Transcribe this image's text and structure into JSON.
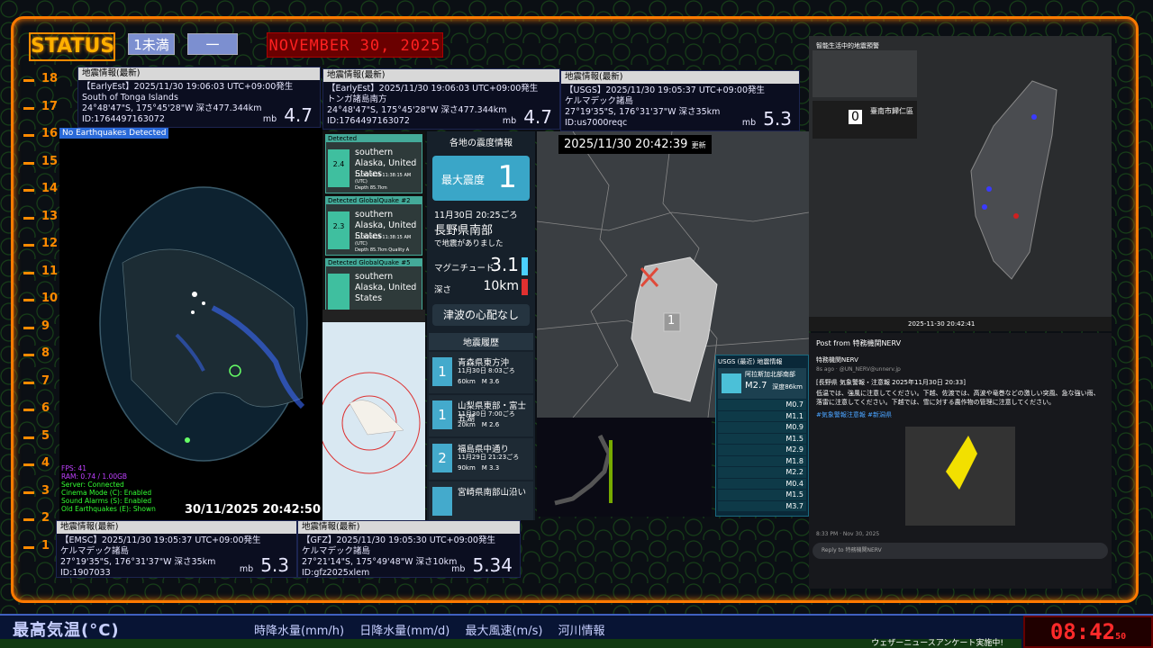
{
  "header": {
    "status": "STATUS",
    "pill1": "1未満",
    "pill2": "一",
    "date": "NOVEMBER 30, 2025"
  },
  "scale": [
    "18",
    "17",
    "16",
    "15",
    "14",
    "13",
    "12",
    "11",
    "10",
    "9",
    "8",
    "7",
    "6",
    "5",
    "4",
    "3",
    "2",
    "1"
  ],
  "cards": [
    {
      "hd": "地震情報(最新)",
      "l1": "【EarlyEst】2025/11/30 19:06:03 UTC+09:00発生",
      "l2": "South of Tonga Islands",
      "l3": "24°48'47\"S, 175°45'28\"W 深さ477.344km",
      "l4": "ID:1764497163072",
      "mb": "mb",
      "val": "4.7"
    },
    {
      "hd": "地震情報(最新)",
      "l1": "【EarlyEst】2025/11/30 19:06:03 UTC+09:00発生",
      "l2": "トンガ諸島南方",
      "l3": "24°48'47\"S, 175°45'28\"W 深さ477.344km",
      "l4": "ID:1764497163072",
      "mb": "mb",
      "val": "4.7"
    },
    {
      "hd": "地震情報(最新)",
      "l1": "【USGS】2025/11/30 19:05:37 UTC+09:00発生",
      "l2": "ケルマデック諸島",
      "l3": "27°19'35\"S, 176°31'37\"W 深さ35km",
      "l4": "ID:us7000reqc",
      "mb": "mb",
      "val": "5.3"
    },
    {
      "hd": "地震情報(最新)",
      "l1": "【EMSC】2025/11/30 19:05:37 UTC+09:00発生",
      "l2": "ケルマデック諸島",
      "l3": "27°19'35\"S, 176°31'37\"W 深さ35km",
      "l4": "ID:1907033",
      "mb": "mb",
      "val": "5.3"
    },
    {
      "hd": "地震情報(最新)",
      "l1": "【GFZ】2025/11/30 19:05:30 UTC+09:00発生",
      "l2": "ケルマデック諸島",
      "l3": "27°21'14\"S, 175°49'48\"W 深さ10km",
      "l4": "ID:gfz2025xlem",
      "mb": "mb",
      "val": "5.34"
    }
  ],
  "globe": {
    "tag": "No Earthquakes Detected",
    "stats": [
      "FPS: 41",
      "RAM: 0.74 / 1.00GB",
      "Server: Connected",
      "Cinema Mode (C): Enabled",
      "Sound Alarms (S): Enabled",
      "Old Earthquakes (E): Shown"
    ],
    "timestamp": "30/11/2025 20:42:50"
  },
  "gq": {
    "items": [
      {
        "tag": "Detected",
        "src": "",
        "num": "",
        "place": "southern Alaska, United States",
        "mag": "2.4",
        "meta1": "11/30/2025 11:38:15 AM (UTC)",
        "meta2": "Depth 85.7km"
      },
      {
        "tag": "Detected",
        "src": "GlobalQuake",
        "num": "#2",
        "place": "southern Alaska, United States",
        "mag": "2.3",
        "meta1": "11/30/2025 11:38:15 AM (UTC)",
        "meta2": "Depth 85.7km  Quality A"
      },
      {
        "tag": "Detected",
        "src": "GlobalQuake",
        "num": "#5",
        "place": "southern Alaska, United States",
        "mag": "",
        "meta1": "",
        "meta2": ""
      }
    ]
  },
  "shindo": {
    "header": "各地の震度情報",
    "max_label": "最大震度",
    "max_val": "1",
    "datetime": "11月30日 20:25ごろ",
    "place": "長野県南部",
    "msg": "で地震がありました",
    "mag_label": "マグニチュード",
    "mag_val": "3.1",
    "depth_label": "深さ",
    "depth_val": "10km",
    "tsunami": "津波の心配なし",
    "history_label": "地震履歴",
    "history": [
      {
        "lvl": "1",
        "place": "青森県東方沖",
        "time": "11月30日 8:03ごろ",
        "depth": "60km",
        "mag": "M 3.6"
      },
      {
        "lvl": "1",
        "place": "山梨県東部・富士五湖",
        "time": "11月30日 7:00ごろ",
        "depth": "20km",
        "mag": "M 2.6"
      },
      {
        "lvl": "2",
        "place": "福島県中通り",
        "time": "11月29日 21:23ごろ",
        "depth": "90km",
        "mag": "M 3.3"
      },
      {
        "lvl": "",
        "place": "宮崎県南部山沿い",
        "time": "",
        "depth": "",
        "mag": ""
      }
    ]
  },
  "map": {
    "time": "2025/11/30 20:42:39",
    "upd": "更新",
    "lvl": "1"
  },
  "usgs": {
    "hd": "USGS (最近) 地震情報",
    "place": "阿拉斯加北部南部",
    "mag": "M2.7",
    "depth": "深度86km",
    "list": [
      "M0.7",
      "M1.1",
      "M0.9",
      "M1.5",
      "M2.9",
      "M1.8",
      "M2.2",
      "M0.4",
      "M1.5",
      "M3.7"
    ]
  },
  "tw": {
    "title": "智能生活中的地震預警",
    "zero": "0",
    "place": "臺南市歸仁區",
    "ts": "2025-11-30 20:42:41"
  },
  "post": {
    "back": "Post from 特務機関NERV",
    "name": "特務機関NERV",
    "handle": "8s ago · @UN_NERV@unnerv.jp",
    "body1": "[長野県 気象警報・注意報 2025年11月30日 20:33]",
    "body2": "低温では、強風に注意してください。下越、佐渡では、高波や竜巻などの激しい突風、急な強い雨、落雷に注意してください。下越では、雪に対する農作物の管理に注意してください。",
    "tags": "#気象警報注意報 #新潟県",
    "foot": "8:33 PM · Nov 30, 2025",
    "reply": "Reply to 特務機関NERV"
  },
  "bottom": {
    "t1": "最高気温(°C)",
    "t2": "時降水量(mm/h)　 日降水量(mm/d)　 最大風速(m/s)　 河川情報",
    "ticker": "ウェザーニュースアンケート実施中!",
    "clock": "08:42",
    "sec": "50"
  }
}
